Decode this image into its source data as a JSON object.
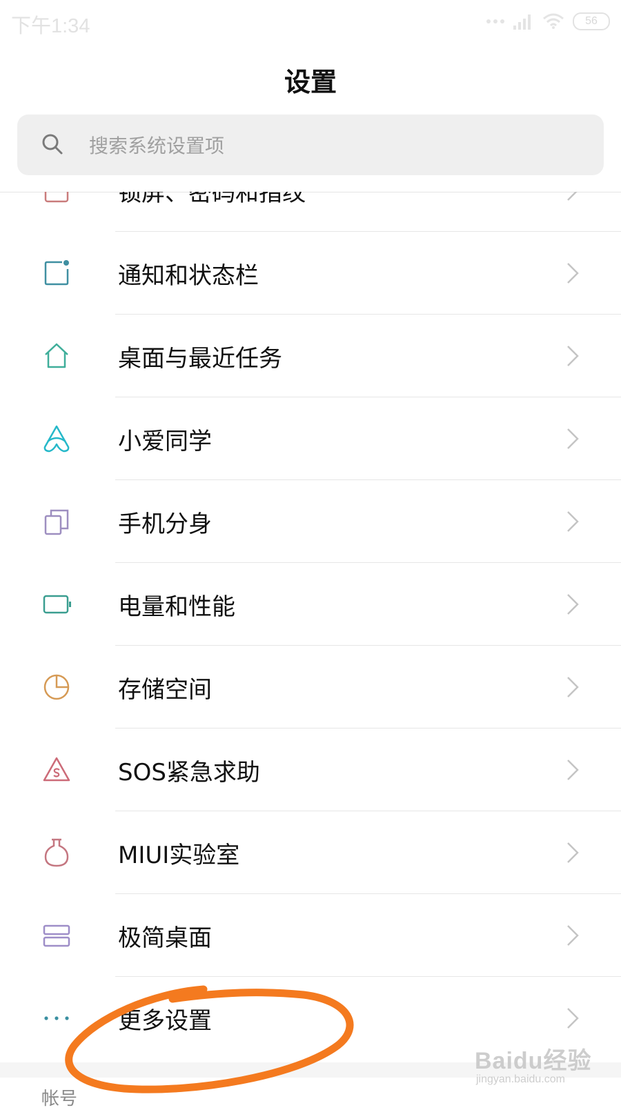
{
  "status_bar": {
    "time": "下午1:34",
    "battery": "56"
  },
  "header": {
    "title": "设置"
  },
  "search": {
    "placeholder": "搜索系统设置项"
  },
  "menu": {
    "items": [
      {
        "label": "锁屏、密码和指纹",
        "icon": "lock-screen-icon",
        "color": "#c97b7b"
      },
      {
        "label": "通知和状态栏",
        "icon": "notification-icon",
        "color": "#3f8fa1"
      },
      {
        "label": "桌面与最近任务",
        "icon": "home-icon",
        "color": "#3fae9a"
      },
      {
        "label": "小爱同学",
        "icon": "xiaoai-icon",
        "color": "#25b8c9"
      },
      {
        "label": "手机分身",
        "icon": "second-space-icon",
        "color": "#9d8ec0"
      },
      {
        "label": "电量和性能",
        "icon": "battery-icon",
        "color": "#3a9e90"
      },
      {
        "label": "存储空间",
        "icon": "storage-icon",
        "color": "#d69a55"
      },
      {
        "label": "SOS紧急求助",
        "icon": "sos-icon",
        "color": "#cc6b78"
      },
      {
        "label": "MIUI实验室",
        "icon": "lab-flask-icon",
        "color": "#c47680"
      },
      {
        "label": "极简桌面",
        "icon": "simple-desktop-icon",
        "color": "#9e8ec8"
      },
      {
        "label": "更多设置",
        "icon": "more-dots-icon",
        "color": "#3a8fa1"
      }
    ]
  },
  "next_section": {
    "label": "帐号"
  },
  "watermark": {
    "brand": "Baidu经验",
    "url": "jingyan.baidu.com"
  },
  "annotation": {
    "color": "#f47a1f"
  }
}
